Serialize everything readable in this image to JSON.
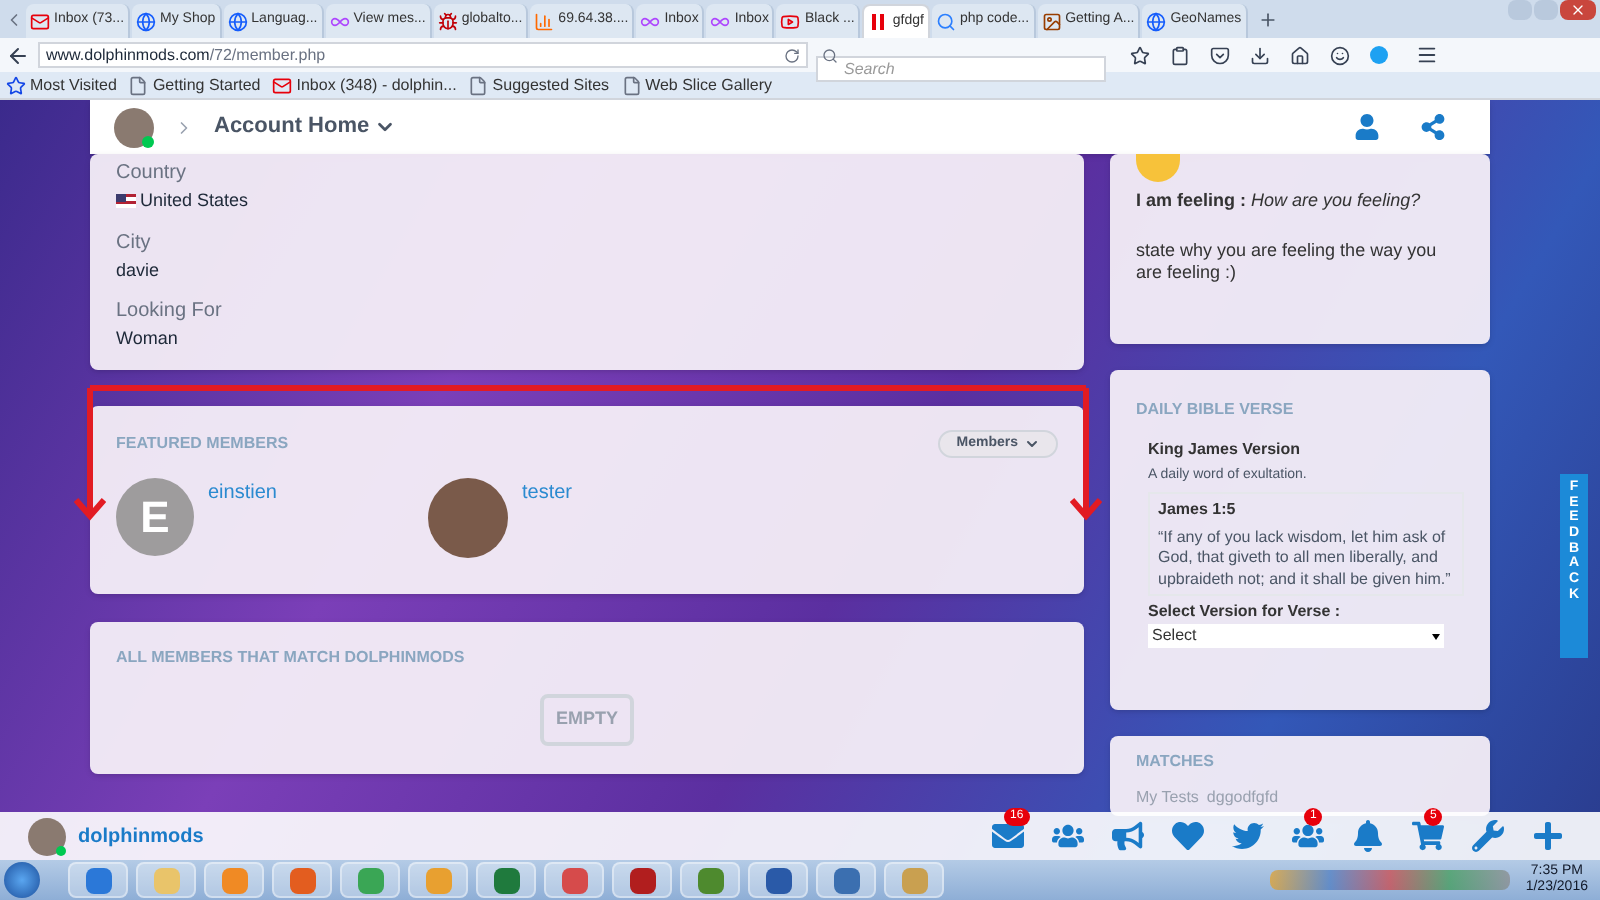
{
  "browser": {
    "tabs": [
      {
        "label": "Inbox (73...",
        "selected": false
      },
      {
        "label": "My Shop",
        "selected": false
      },
      {
        "label": "Languag...",
        "selected": false
      },
      {
        "label": "View mes...",
        "selected": false
      },
      {
        "label": "globalto...",
        "selected": false
      },
      {
        "label": "69.64.38....",
        "selected": false
      },
      {
        "label": "Inbox",
        "selected": false
      },
      {
        "label": "Inbox",
        "selected": false
      },
      {
        "label": "Black ...",
        "selected": false
      },
      {
        "label": "gfdgf",
        "selected": true
      },
      {
        "label": "php code...",
        "selected": false
      },
      {
        "label": "Getting A...",
        "selected": false
      },
      {
        "label": "GeoNames",
        "selected": false
      }
    ],
    "url": {
      "domain": "www.dolphinmods.com",
      "path": "/72/member.php"
    },
    "search": {
      "placeholder": "Search"
    },
    "bookmarks": [
      "Most Visited",
      "Getting Started",
      "Inbox (348) - dolphin...",
      "Suggested Sites",
      "Web Slice Gallery"
    ]
  },
  "header": {
    "title": "Account Home"
  },
  "profile": {
    "fields": [
      {
        "label": "Country",
        "value": "United States"
      },
      {
        "label": "City",
        "value": "davie"
      },
      {
        "label": "Looking For",
        "value": "Woman"
      }
    ]
  },
  "featured": {
    "title": "FEATURED MEMBERS",
    "filter": "Members",
    "members": [
      {
        "name": "einstien",
        "kind": "letter",
        "initial": "E"
      },
      {
        "name": "tester",
        "kind": "photo"
      }
    ]
  },
  "all_members": {
    "title": "ALL MEMBERS THAT MATCH DOLPHINMODS",
    "empty": "EMPTY"
  },
  "feeling": {
    "label": "I am feeling :",
    "value": "How are you feeling?",
    "reason": "state why you are feeling the way you are feeling :)"
  },
  "bible": {
    "title": "DAILY BIBLE VERSE",
    "version": "King James Version",
    "subtitle": "A daily word of exultation.",
    "reference": "James 1:5",
    "verse": "“If any of you lack wisdom, let him ask of God, that giveth to all men liberally, and upbraideth not; and it shall be given him.”",
    "select_label": "Select Version for Verse :",
    "select_value": "Select"
  },
  "matches": {
    "title": "MATCHES",
    "items": [
      "My Tests",
      "dggodfgfd"
    ]
  },
  "feedback": "FEEDBACK",
  "bottom_bar": {
    "username": "dolphinmods",
    "icons": [
      {
        "kind": "mail",
        "badge": "16"
      },
      {
        "kind": "users"
      },
      {
        "kind": "megaphone"
      },
      {
        "kind": "heart"
      },
      {
        "kind": "bird"
      },
      {
        "kind": "users",
        "badge": "1"
      },
      {
        "kind": "bell"
      },
      {
        "kind": "cart",
        "badge": "5"
      },
      {
        "kind": "wrench"
      },
      {
        "kind": "plus"
      }
    ]
  },
  "taskbar": {
    "time": "7:35 PM",
    "date": "1/23/2016"
  }
}
